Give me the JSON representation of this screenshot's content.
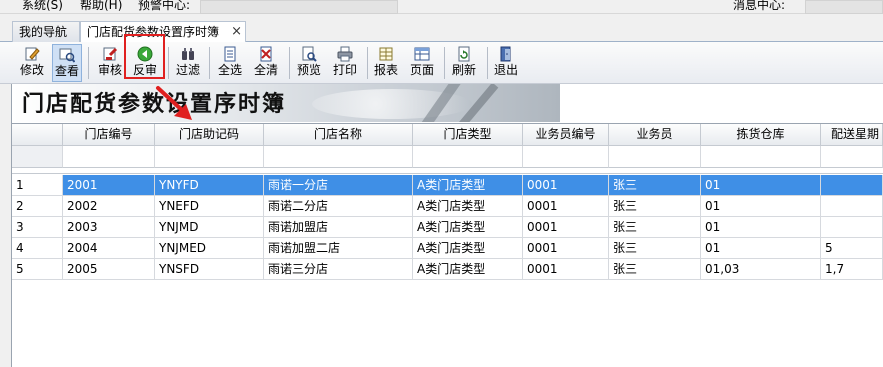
{
  "menu": {
    "items": [
      "系统(S)",
      "帮助(H)",
      "预警中心:"
    ],
    "message_center": "消息中心:"
  },
  "tabs": [
    {
      "label": "我的导航"
    },
    {
      "label": "门店配货参数设置序时簿",
      "close": "×"
    }
  ],
  "toolbar": {
    "buttons": [
      {
        "label": "修改",
        "icon": "edit-icon"
      },
      {
        "label": "查看",
        "icon": "view-icon"
      },
      {
        "label": "审核",
        "icon": "audit-icon"
      },
      {
        "label": "反审",
        "icon": "unaudit-icon"
      },
      {
        "label": "过滤",
        "icon": "filter-icon"
      },
      {
        "label": "全选",
        "icon": "select-all-icon"
      },
      {
        "label": "全清",
        "icon": "clear-all-icon"
      },
      {
        "label": "预览",
        "icon": "preview-icon"
      },
      {
        "label": "打印",
        "icon": "print-icon"
      },
      {
        "label": "报表",
        "icon": "report-icon"
      },
      {
        "label": "页面",
        "icon": "page-icon"
      },
      {
        "label": "刷新",
        "icon": "refresh-icon"
      },
      {
        "label": "退出",
        "icon": "exit-icon"
      }
    ]
  },
  "banner": {
    "title": "门店配货参数设置序时簿"
  },
  "grid": {
    "columns": [
      "门店编号",
      "门店助记码",
      "门店名称",
      "门店类型",
      "业务员编号",
      "业务员",
      "拣货仓库",
      "配送星期"
    ],
    "rows": [
      {
        "n": "1",
        "cells": [
          "2001",
          "YNYFD",
          "雨诺一分店",
          "A类门店类型",
          "0001",
          "张三",
          "01",
          ""
        ]
      },
      {
        "n": "2",
        "cells": [
          "2002",
          "YNEFD",
          "雨诺二分店",
          "A类门店类型",
          "0001",
          "张三",
          "01",
          ""
        ]
      },
      {
        "n": "3",
        "cells": [
          "2003",
          "YNJMD",
          "雨诺加盟店",
          "A类门店类型",
          "0001",
          "张三",
          "01",
          ""
        ]
      },
      {
        "n": "4",
        "cells": [
          "2004",
          "YNJMED",
          "雨诺加盟二店",
          "A类门店类型",
          "0001",
          "张三",
          "01",
          "5"
        ]
      },
      {
        "n": "5",
        "cells": [
          "2005",
          "YNSFD",
          "雨诺三分店",
          "A类门店类型",
          "0001",
          "张三",
          "01,03",
          "1,7"
        ]
      }
    ],
    "selected_row": 1
  },
  "colors": {
    "selection": "#3f8fe6",
    "highlight": "#e02020"
  }
}
